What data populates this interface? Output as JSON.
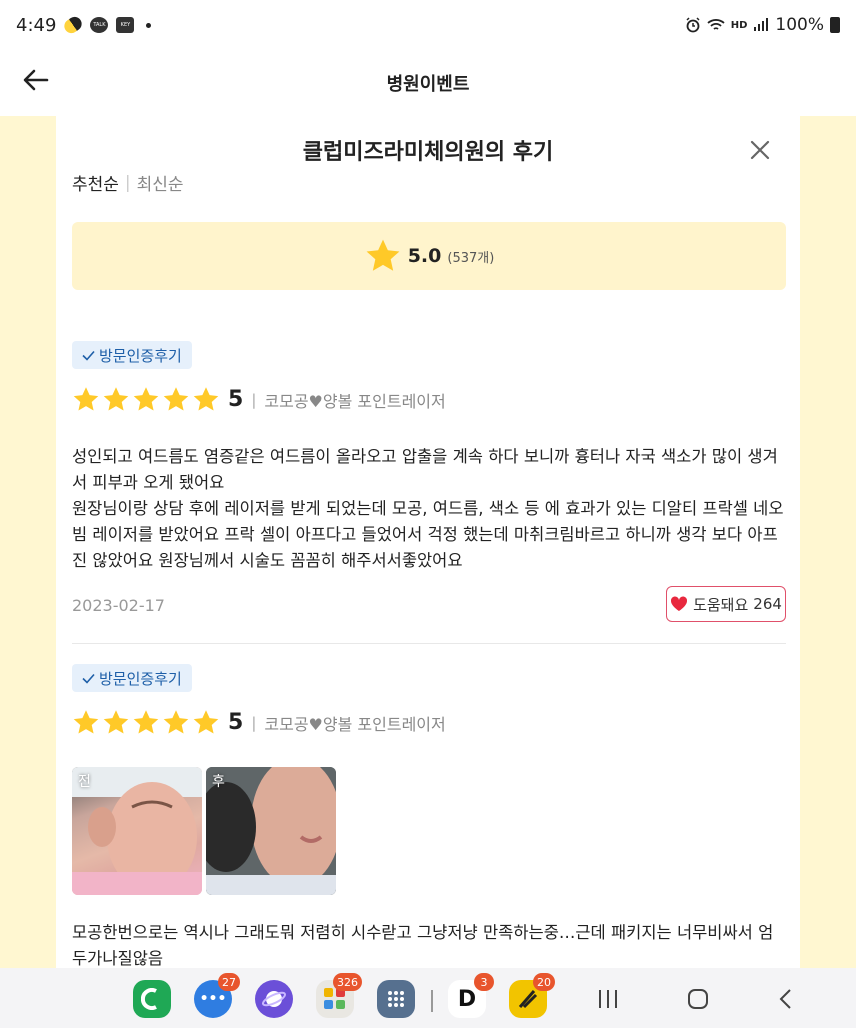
{
  "status_bar": {
    "time": "4:49",
    "talk_label": "TALK",
    "key_label": "KEY",
    "hd_label": "HD",
    "battery": "100%"
  },
  "header": {
    "title": "병원이벤트"
  },
  "modal": {
    "title": "클럽미즈라미체의원의 후기",
    "sort_active": "추천순",
    "sort_divider": "|",
    "sort_inactive": "최신순"
  },
  "rating_summary": {
    "value": "5.0",
    "count": "(537개)"
  },
  "reviews": [
    {
      "badge": "방문인증후기",
      "score": "5",
      "rating": 5,
      "product": "코모공♥양볼 포인트레이저",
      "text": "성인되고 여드름도 염증같은 여드름이 올라오고 압출을 계속 하다 보니까 흉터나 자국 색소가 많이 생겨서 피부과 오게 됐어요\n원장님이랑 상담 후에 레이저를 받게 되었는데 모공, 여드름, 색소 등 에 효과가 있는 디알티 프락셀 네오빔 레이저를 받았어요 프락 셀이 아프다고 들었어서 걱정 했는데 마취크림바르고 하니까 생각 보다 아프진 않았어요 원장님께서 시술도 꼼꼼히 해주서서좋았어요",
      "date": "2023-02-17",
      "helpful_label": "도움돼요",
      "helpful_count": "264"
    },
    {
      "badge": "방문인증후기",
      "score": "5",
      "rating": 5,
      "product": "코모공♥양볼 포인트레이저",
      "photo_before": "전",
      "photo_after": "후",
      "text": "모공한번으로는 역시나 그래도뭐 저렴히 시수랃고 그냥저냥 만족하는중…근데 패키지는 너무비싸서 엄두가나질않음"
    }
  ],
  "nav_bar": {
    "apps": [
      {
        "icon": "phone-app-icon",
        "color": "#1fa855",
        "badge": ""
      },
      {
        "icon": "messages-app-icon",
        "color": "#2f7de1",
        "badge": "27"
      },
      {
        "icon": "internet-app-icon",
        "color": "#6b4fd8",
        "badge": ""
      },
      {
        "icon": "app-folder-icon",
        "color": "#e9e7e2",
        "badge": "326"
      },
      {
        "icon": "app-drawer-icon",
        "color": "#56708f",
        "badge": ""
      },
      {
        "icon": "d-app-icon",
        "color": "#ffffff",
        "badge": "3",
        "letter": "D"
      },
      {
        "icon": "yellow-app-icon",
        "color": "#f2c400",
        "badge": "20"
      }
    ]
  }
}
